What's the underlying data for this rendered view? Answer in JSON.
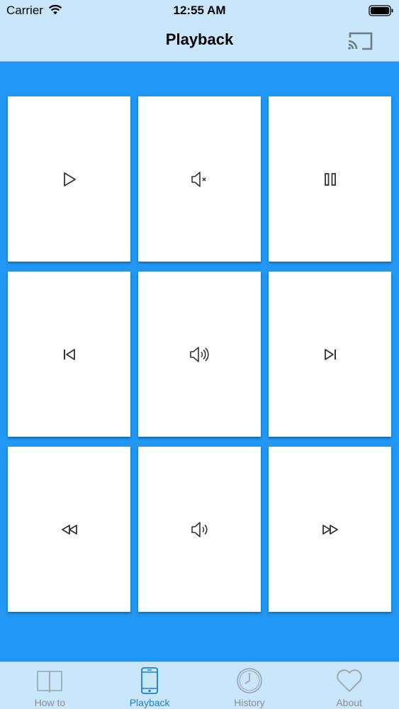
{
  "status_bar": {
    "carrier": "Carrier",
    "time": "12:55 AM"
  },
  "nav": {
    "title": "Playback",
    "cast_icon": "cast-icon"
  },
  "tiles": [
    {
      "icon": "play-icon"
    },
    {
      "icon": "mute-icon"
    },
    {
      "icon": "pause-icon"
    },
    {
      "icon": "skip-previous-icon"
    },
    {
      "icon": "volume-up-icon"
    },
    {
      "icon": "skip-next-icon"
    },
    {
      "icon": "rewind-icon"
    },
    {
      "icon": "volume-down-icon"
    },
    {
      "icon": "fast-forward-icon"
    }
  ],
  "tab_bar": {
    "items": [
      {
        "label": "How to",
        "icon": "book-icon",
        "active": false
      },
      {
        "label": "Playback",
        "icon": "phone-icon",
        "active": true
      },
      {
        "label": "History",
        "icon": "clock-icon",
        "active": false
      },
      {
        "label": "About",
        "icon": "heart-icon",
        "active": false
      }
    ]
  },
  "colors": {
    "background": "#2196F3",
    "bar": "#C9E6FA",
    "active_tab": "#1A7FD8",
    "inactive_tab": "#8e8e93"
  }
}
